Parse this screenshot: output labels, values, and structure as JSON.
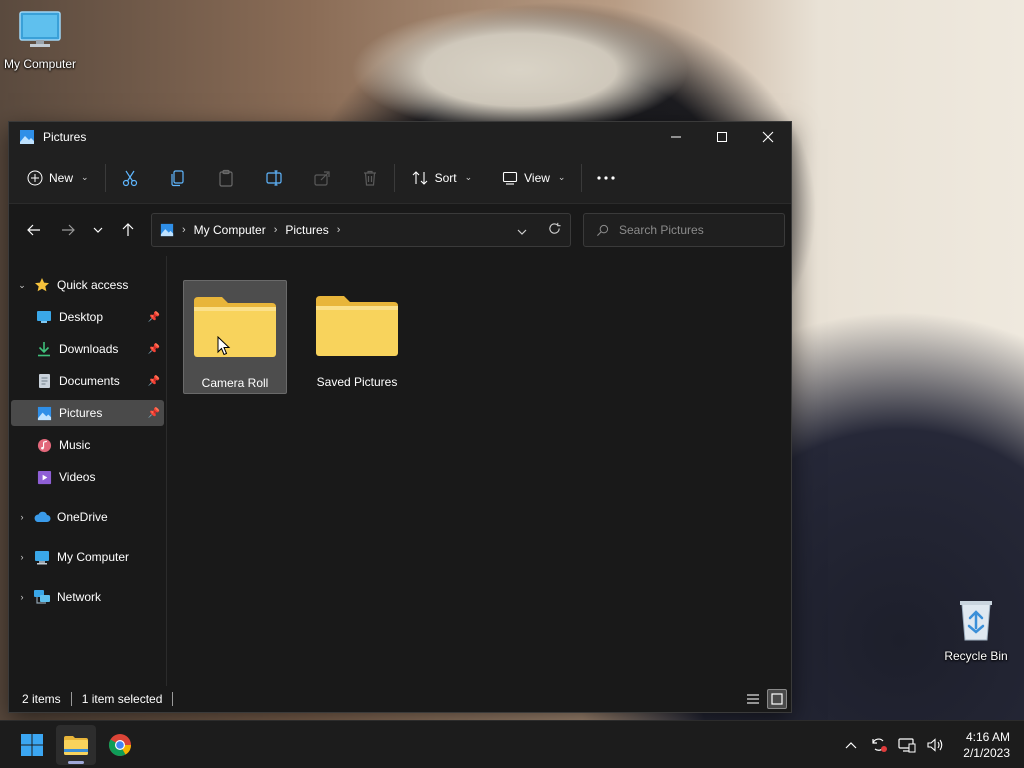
{
  "desktop": {
    "my_computer_label": "My Computer",
    "recycle_bin_label": "Recycle Bin"
  },
  "window": {
    "title": "Pictures",
    "controls": {
      "minimize": "minimize",
      "maximize": "maximize",
      "close": "close"
    }
  },
  "toolbar": {
    "new_label": "New",
    "sort_label": "Sort",
    "view_label": "View",
    "icons": [
      "cut-icon",
      "copy-icon",
      "paste-icon",
      "rename-icon",
      "share-icon",
      "delete-icon",
      "more-icon"
    ]
  },
  "address": {
    "crumbs": [
      "My Computer",
      "Pictures"
    ]
  },
  "search": {
    "placeholder": "Search Pictures"
  },
  "sidebar": {
    "quick_access": "Quick access",
    "items": [
      {
        "label": "Desktop",
        "pinned": true
      },
      {
        "label": "Downloads",
        "pinned": true
      },
      {
        "label": "Documents",
        "pinned": true
      },
      {
        "label": "Pictures",
        "pinned": true,
        "selected": true
      },
      {
        "label": "Music",
        "pinned": false
      },
      {
        "label": "Videos",
        "pinned": false
      }
    ],
    "roots": [
      "OneDrive",
      "My Computer",
      "Network"
    ]
  },
  "content": {
    "folders": [
      {
        "name": "Camera Roll",
        "selected": true
      },
      {
        "name": "Saved Pictures",
        "selected": false
      }
    ]
  },
  "status": {
    "item_count": "2 items",
    "selection": "1 item selected"
  },
  "taskbar": {
    "time": "4:16 AM",
    "date": "2/1/2023"
  },
  "colors": {
    "folder_yellow": "#f8d35c",
    "folder_tab": "#e8b53a",
    "accent_blue": "#4aa3ff"
  }
}
